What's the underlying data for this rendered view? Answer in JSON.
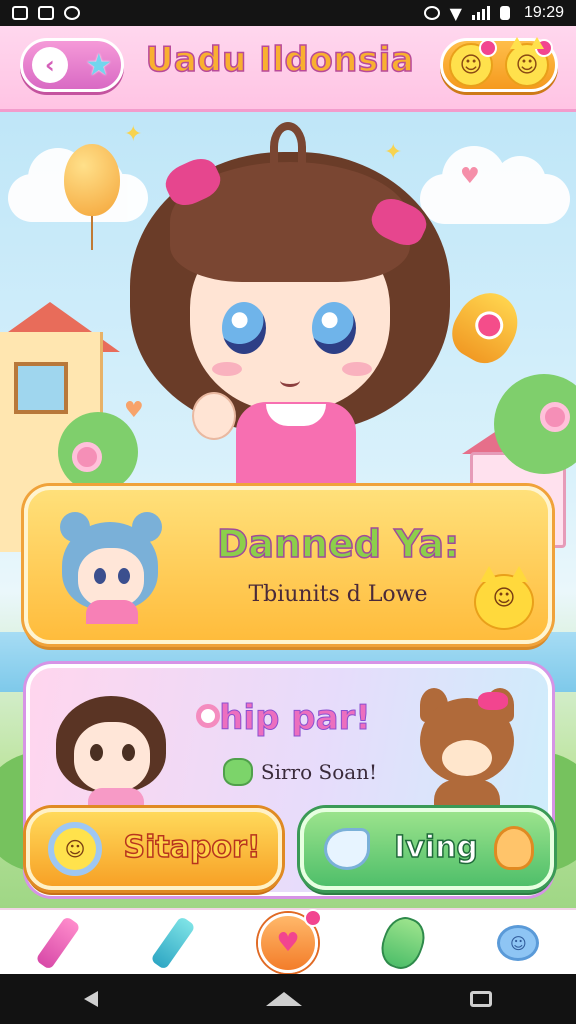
{
  "status_bar": {
    "time": "19:29",
    "left_icons": [
      "notification-icon",
      "gallery-icon",
      "sync-icon"
    ],
    "right_icons": [
      "alarm-icon",
      "wifi-icon",
      "signal-icon",
      "battery-icon"
    ]
  },
  "header": {
    "title": "Uadu Ildonsia",
    "back_icon": "chevron-left-icon",
    "star_icon": "star-icon",
    "right_icons": [
      "smiley-face-icon",
      "cat-face-icon"
    ]
  },
  "card_featured": {
    "title": "Danned Ya:",
    "subtitle": "Tbiunits d Lowe",
    "avatar": "blue-hair-girl-avatar",
    "action_icon": "cat-face-icon"
  },
  "card_chip": {
    "title": "hip par!",
    "subtitle": "Sirro Soan!",
    "avatar": "brown-hair-girl-avatar",
    "companion": "bear-mascot"
  },
  "buttons": {
    "primary_label": "Sitapor!",
    "secondary_label": "Iving"
  },
  "bottom_nav": {
    "items": [
      "pink-crayon-icon",
      "teal-crayon-icon",
      "heart-icon",
      "frog-icon",
      "candy-icon"
    ],
    "active": "heart-icon"
  },
  "colors": {
    "header_pink": "#ffc4e4",
    "title_orange": "#f9b030",
    "card_yellow": "#ffbc3c",
    "accent_green": "#4fbf6a",
    "accent_pink": "#f2458f"
  }
}
